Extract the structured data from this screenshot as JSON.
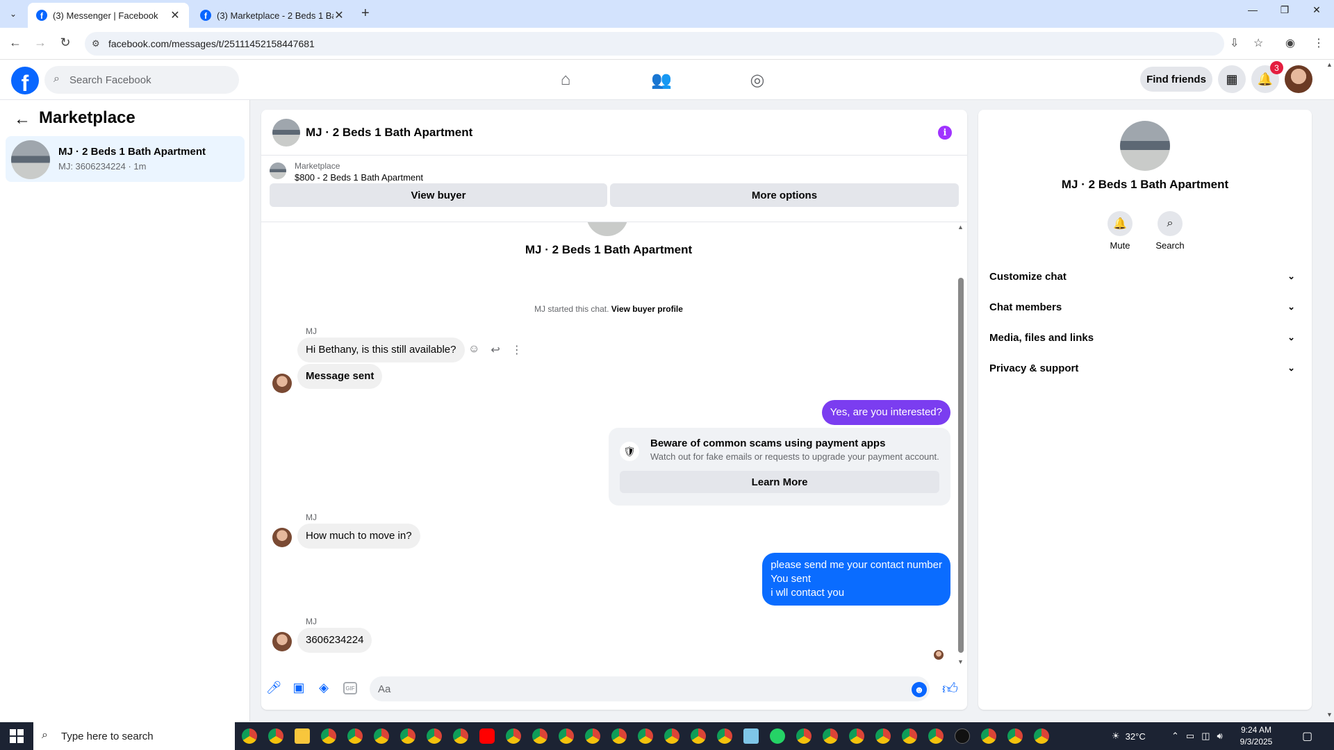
{
  "browser": {
    "tabs": [
      {
        "title": "(3) Messenger | Facebook",
        "active": true
      },
      {
        "title": "(3) Marketplace - 2 Beds 1 Bath",
        "active": false
      }
    ],
    "url": "facebook.com/messages/t/25111452158447681"
  },
  "fb_header": {
    "search_placeholder": "Search Facebook",
    "find_friends": "Find friends",
    "notification_count": "3"
  },
  "sidebar": {
    "title": "Marketplace",
    "conversations": [
      {
        "name": "MJ · 2 Beds 1 Bath Apartment",
        "preview": "MJ: 3606234224 · 1m"
      }
    ]
  },
  "chat": {
    "title": "MJ · 2 Beds 1 Bath Apartment",
    "listing": {
      "label": "Marketplace",
      "summary": "$800 - 2 Beds 1 Bath Apartment",
      "view_buyer": "View buyer",
      "more_options": "More options"
    },
    "conversation_name": "MJ · 2 Beds 1 Bath Apartment",
    "started_text": "MJ started this chat.",
    "view_profile": "View buyer profile",
    "sender": "MJ",
    "messages": {
      "m1": "Hi Bethany, is this still available?",
      "m2": "Message sent",
      "m3": "Yes, are you interested?",
      "m4": "How much to move in?",
      "m5_line1": "please send me your contact number",
      "m5_line2": "You sent",
      "m5_line3": "i wll contact you",
      "m6": "3606234224"
    },
    "scam_notice": {
      "title": "Beware of common scams using payment apps",
      "body": "Watch out for fake emails or requests to upgrade your payment account.",
      "button": "Learn More"
    },
    "composer_placeholder": "Aa",
    "colors": {
      "outgoing_purple": "#7b3df0",
      "outgoing_blue": "#0a6cff"
    }
  },
  "info_panel": {
    "name": "MJ · 2 Beds 1 Bath Apartment",
    "mute": "Mute",
    "search": "Search",
    "sections": [
      "Customize chat",
      "Chat members",
      "Media, files and links",
      "Privacy & support"
    ]
  },
  "taskbar": {
    "search_placeholder": "Type here to search",
    "weather": "32°C",
    "time": "9:24 AM",
    "date": "9/3/2025"
  }
}
